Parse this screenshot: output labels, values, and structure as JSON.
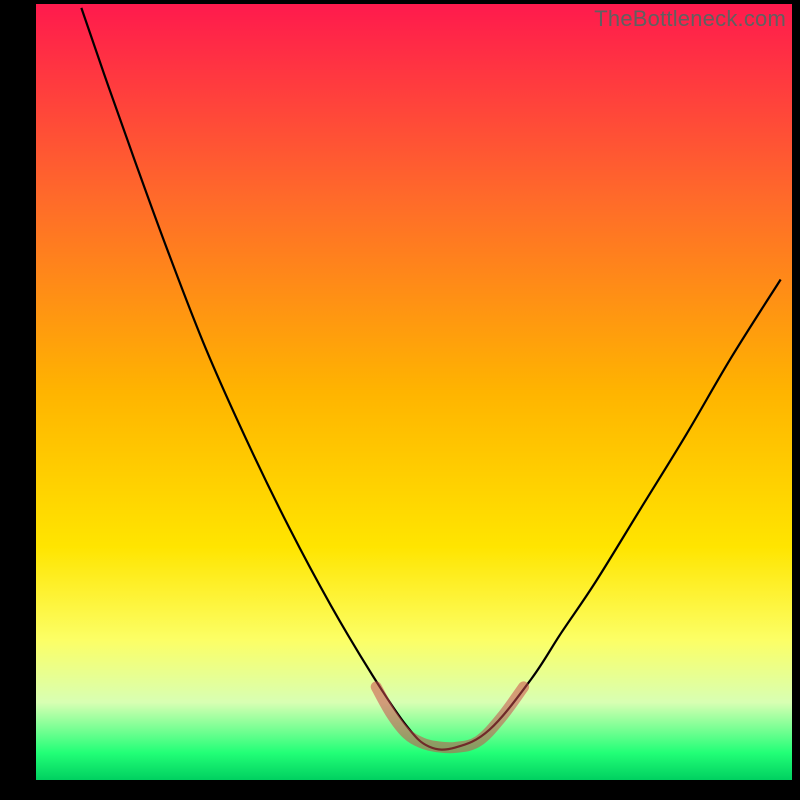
{
  "watermark": "TheBottleneck.com",
  "chart_data": {
    "type": "line",
    "title": "",
    "xlabel": "",
    "ylabel": "",
    "xlim": [
      0,
      1
    ],
    "ylim": [
      0,
      1
    ],
    "background_gradient": {
      "stops": [
        {
          "pos": 0.0,
          "color": "#ff1a4d"
        },
        {
          "pos": 0.25,
          "color": "#ff6a2a"
        },
        {
          "pos": 0.5,
          "color": "#ffb400"
        },
        {
          "pos": 0.7,
          "color": "#ffe500"
        },
        {
          "pos": 0.82,
          "color": "#fcff66"
        },
        {
          "pos": 0.9,
          "color": "#d8ffb3"
        },
        {
          "pos": 0.965,
          "color": "#22ff77"
        },
        {
          "pos": 1.0,
          "color": "#00d060"
        }
      ]
    },
    "frame": {
      "left": 0.045,
      "right": 0.99,
      "top": 0.005,
      "bottom": 0.975,
      "stroke": "#000",
      "stroke_width_left": 34,
      "stroke_width_right": 6,
      "stroke_width_top": 4,
      "stroke_width_bottom": 18
    },
    "series": [
      {
        "name": "bottleneck-curve",
        "stroke": "#000000",
        "stroke_width": 2.2,
        "x": [
          0.06,
          0.09,
          0.13,
          0.175,
          0.225,
          0.28,
          0.335,
          0.39,
          0.445,
          0.49,
          0.52,
          0.555,
          0.6,
          0.655,
          0.695,
          0.74,
          0.8,
          0.86,
          0.92,
          0.985
        ],
        "y": [
          0.005,
          0.09,
          0.2,
          0.32,
          0.445,
          0.565,
          0.675,
          0.775,
          0.865,
          0.93,
          0.957,
          0.958,
          0.935,
          0.87,
          0.81,
          0.745,
          0.65,
          0.555,
          0.455,
          0.355
        ]
      },
      {
        "name": "valley-band",
        "stroke": "#cc4a4a",
        "stroke_width": 11,
        "opacity": 0.55,
        "linecap": "round",
        "x": [
          0.45,
          0.47,
          0.49,
          0.51,
          0.53,
          0.555,
          0.585,
          0.615,
          0.645
        ],
        "y": [
          0.88,
          0.915,
          0.94,
          0.952,
          0.957,
          0.958,
          0.95,
          0.92,
          0.88
        ]
      }
    ]
  }
}
